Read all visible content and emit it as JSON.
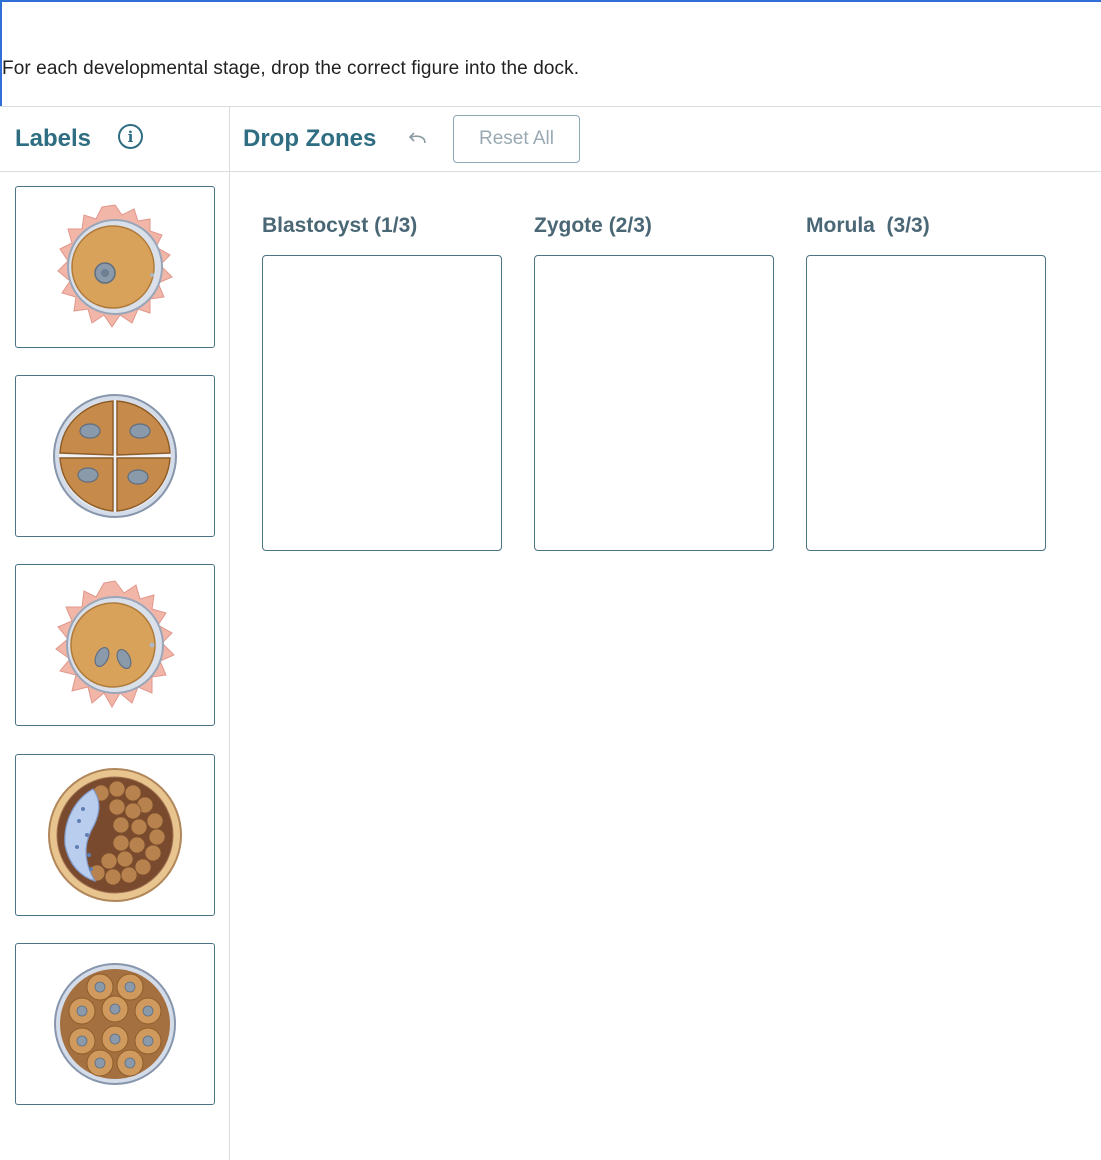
{
  "instructions": "For each developmental stage, drop the correct figure into the dock.",
  "labels_panel": {
    "title": "Labels",
    "info_icon": "info-icon",
    "items": [
      {
        "figure": "oocyte-with-corona-icon"
      },
      {
        "figure": "four-cell-embryo-icon"
      },
      {
        "figure": "fertilized-zygote-icon"
      },
      {
        "figure": "blastocyst-icon"
      },
      {
        "figure": "morula-icon"
      }
    ]
  },
  "drop_panel": {
    "title": "Drop Zones",
    "undo_icon": "undo-icon",
    "reset_label": "Reset All",
    "zones": [
      {
        "name": "Blastocyst",
        "count": "(1/3)"
      },
      {
        "name": "Zygote",
        "count": "(2/3)"
      },
      {
        "name": "Morula",
        "count": "(3/3)"
      }
    ]
  },
  "colors": {
    "accent": "#2e6d82",
    "top_border": "#2f6fd6",
    "card_border": "#4a7384"
  }
}
